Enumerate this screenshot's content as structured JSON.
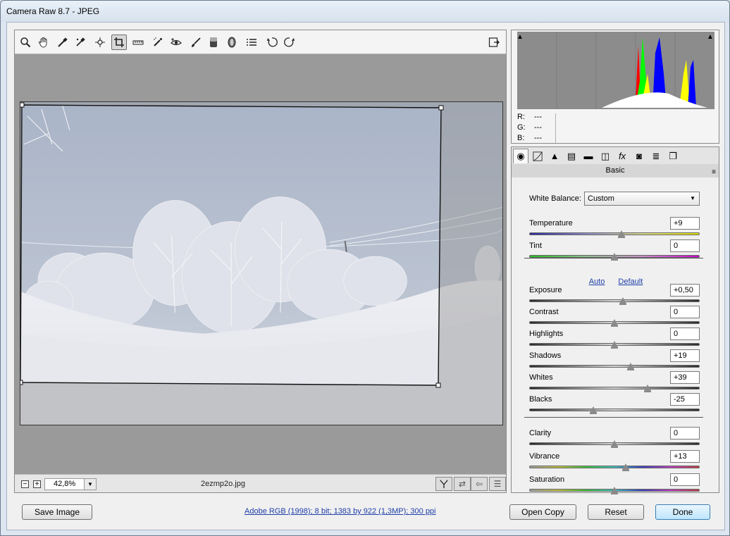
{
  "window": {
    "title": "Camera Raw 8.7  -  JPEG"
  },
  "toolbar": {
    "tools": [
      {
        "name": "zoom-tool"
      },
      {
        "name": "hand-tool"
      },
      {
        "name": "white-balance-tool"
      },
      {
        "name": "color-sampler-tool"
      },
      {
        "name": "targeted-adjustment-tool"
      },
      {
        "name": "crop-tool"
      },
      {
        "name": "straighten-tool"
      },
      {
        "name": "spot-removal-tool"
      },
      {
        "name": "red-eye-tool"
      },
      {
        "name": "adjustment-brush-tool"
      },
      {
        "name": "graduated-filter-tool"
      },
      {
        "name": "radial-filter-tool"
      },
      {
        "name": "preferences-tool"
      },
      {
        "name": "rotate-left-tool"
      },
      {
        "name": "rotate-right-tool"
      }
    ],
    "active_tool": "crop-tool"
  },
  "status": {
    "zoom": "42,8%",
    "filename": "2ezmp2o.jpg"
  },
  "histogram": {
    "rgb": [
      {
        "label": "R:",
        "value": "---"
      },
      {
        "label": "G:",
        "value": "---"
      },
      {
        "label": "B:",
        "value": "---"
      }
    ]
  },
  "panel": {
    "name": "Basic",
    "white_balance_label": "White Balance:",
    "white_balance_value": "Custom",
    "auto_label": "Auto",
    "default_label": "Default",
    "sliders": [
      {
        "id": "temperature",
        "label": "Temperature",
        "value": "+9",
        "pos": 0.54,
        "track": "temp"
      },
      {
        "id": "tint",
        "label": "Tint",
        "value": "0",
        "pos": 0.5,
        "track": "tint"
      },
      {
        "id": "exposure",
        "label": "Exposure",
        "value": "+0,50",
        "pos": 0.55,
        "track": "gray"
      },
      {
        "id": "contrast",
        "label": "Contrast",
        "value": "0",
        "pos": 0.5,
        "track": "gray"
      },
      {
        "id": "highlights",
        "label": "Highlights",
        "value": "0",
        "pos": 0.5,
        "track": "gray"
      },
      {
        "id": "shadows",
        "label": "Shadows",
        "value": "+19",
        "pos": 0.595,
        "track": "gray"
      },
      {
        "id": "whites",
        "label": "Whites",
        "value": "+39",
        "pos": 0.695,
        "track": "gray"
      },
      {
        "id": "blacks",
        "label": "Blacks",
        "value": "-25",
        "pos": 0.375,
        "track": "gray"
      },
      {
        "id": "clarity",
        "label": "Clarity",
        "value": "0",
        "pos": 0.5,
        "track": "gray"
      },
      {
        "id": "vibrance",
        "label": "Vibrance",
        "value": "+13",
        "pos": 0.565,
        "track": "spectrum"
      },
      {
        "id": "saturation",
        "label": "Saturation",
        "value": "0",
        "pos": 0.5,
        "track": "spectrum"
      }
    ]
  },
  "footer": {
    "save_image": "Save Image",
    "workflow_options": "Adobe RGB (1998); 8 bit; 1383 by 922 (1,3MP); 300 ppi",
    "open_copy": "Open Copy",
    "reset": "Reset",
    "done": "Done"
  }
}
